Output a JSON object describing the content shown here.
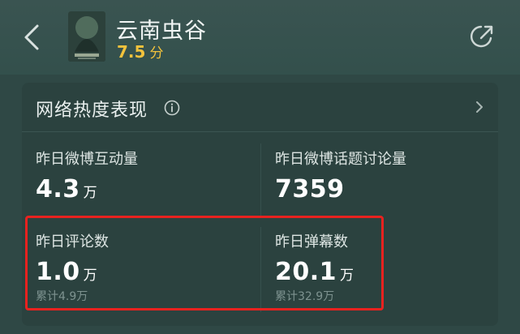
{
  "header": {
    "title": "云南虫谷",
    "rating_score": "7.5",
    "rating_unit": "分"
  },
  "card": {
    "title": "网络热度表现",
    "metrics": [
      {
        "label": "昨日微博互动量",
        "value": "4.3",
        "unit": "万"
      },
      {
        "label": "昨日微博话题讨论量",
        "value": "7359"
      },
      {
        "label": "昨日评论数",
        "value": "1.0",
        "unit": "万",
        "sub": "累计4.9万"
      },
      {
        "label": "昨日弹幕数",
        "value": "20.1",
        "unit": "万",
        "sub": "累计32.9万"
      }
    ]
  },
  "colors": {
    "background": "#2f4845",
    "card": "#2b423f",
    "rating": "#f2c23c",
    "highlight_border": "#e8221f",
    "sub_text": "#7e9390"
  },
  "icons": [
    "back-arrow-icon",
    "share-icon",
    "info-icon",
    "chevron-right-icon"
  ]
}
